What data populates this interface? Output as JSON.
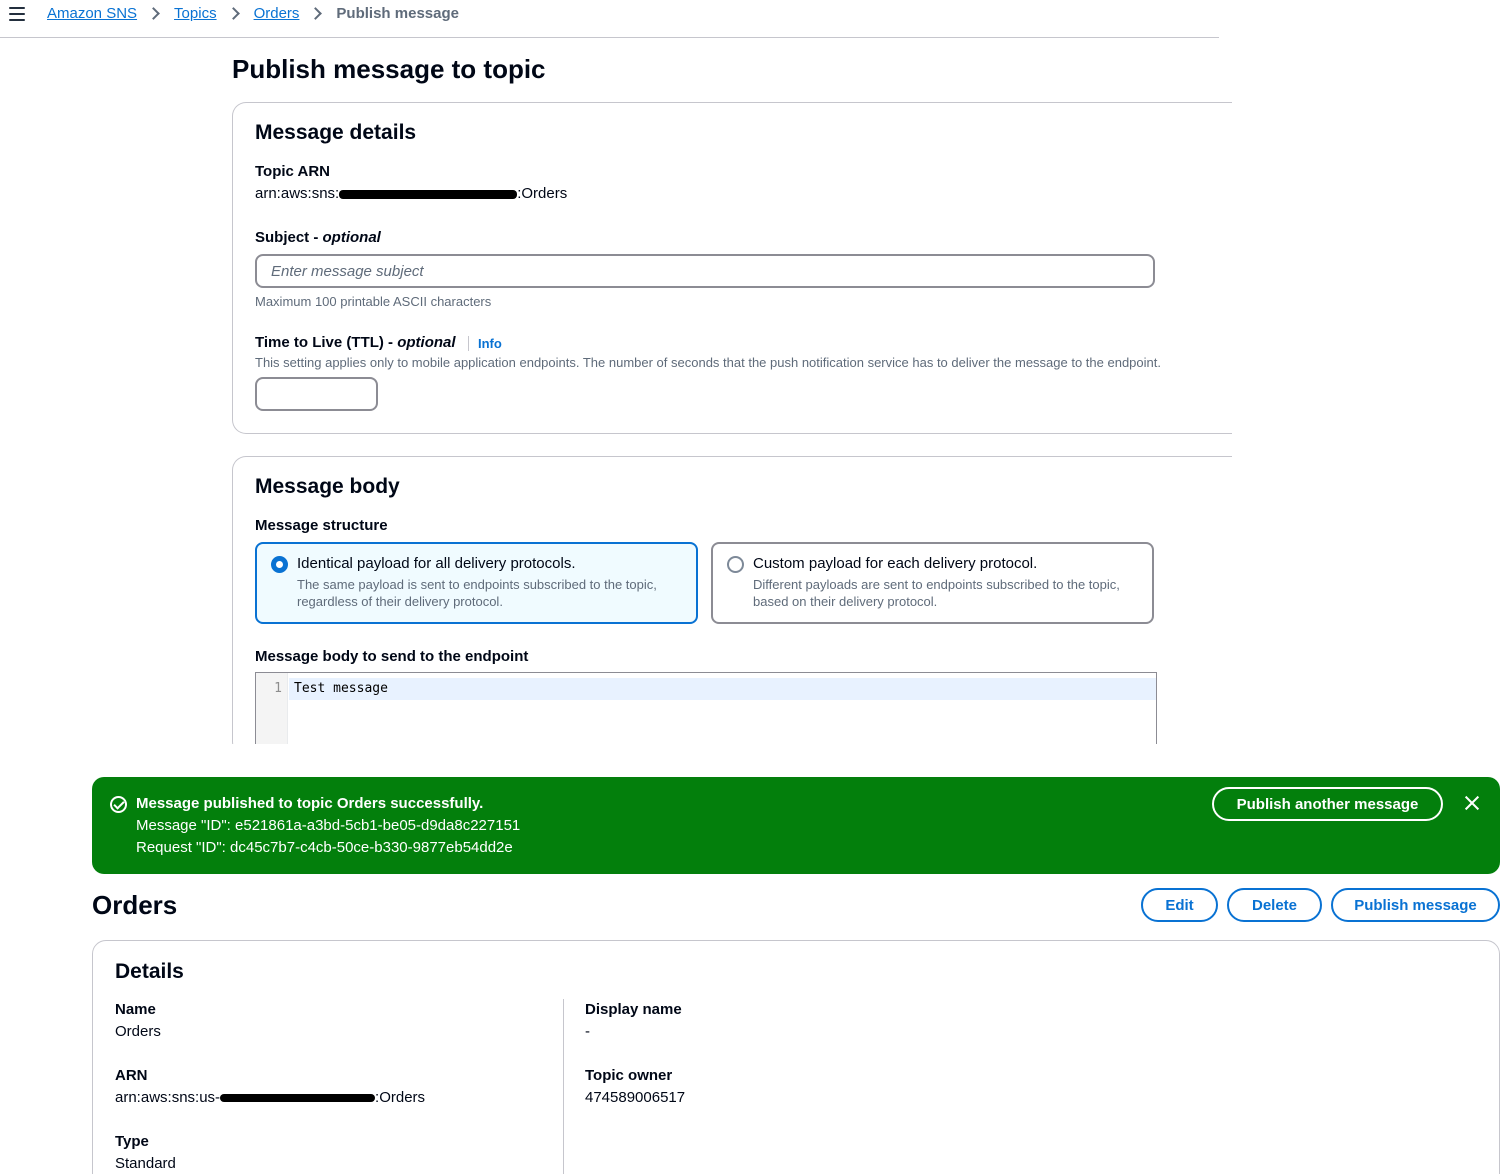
{
  "breadcrumb": {
    "items": [
      "Amazon SNS",
      "Topics",
      "Orders"
    ],
    "current": "Publish message"
  },
  "page_title": "Publish message to topic",
  "message_details": {
    "title": "Message details",
    "topic_arn_label": "Topic ARN",
    "topic_arn_prefix": "arn:aws:sns:",
    "topic_arn_suffix": ":Orders",
    "subject_label": "Subject - ",
    "subject_optional": "optional",
    "subject_placeholder": "Enter message subject",
    "subject_hint": "Maximum 100 printable ASCII characters",
    "ttl_label": "Time to Live (TTL) - ",
    "ttl_optional": "optional",
    "ttl_info": "Info",
    "ttl_hint": "This setting applies only to mobile application endpoints. The number of seconds that the push notification service has to deliver the message to the endpoint.",
    "ttl_value": ""
  },
  "message_body": {
    "title": "Message body",
    "structure_label": "Message structure",
    "options": [
      {
        "title": "Identical payload for all delivery protocols.",
        "description": "The same payload is sent to endpoints subscribed to the topic, regardless of their delivery protocol.",
        "selected": true
      },
      {
        "title": "Custom payload for each delivery protocol.",
        "description": "Different payloads are sent to endpoints subscribed to the topic, based on their delivery protocol.",
        "selected": false
      }
    ],
    "body_label": "Message body to send to the endpoint",
    "editor_line_number": "1",
    "editor_text": "Test message"
  },
  "flash": {
    "color": "#037f0c",
    "title": "Message published to topic Orders successfully.",
    "message_id": "Message \"ID\": e521861a-a3bd-5cb1-be05-d9da8c227151",
    "request_id": "Request \"ID\": dc45c7b7-c4cb-50ce-b330-9877eb54dd2e",
    "button": "Publish another message",
    "close_icon": "close-icon"
  },
  "topic": {
    "title": "Orders",
    "buttons": {
      "edit": "Edit",
      "delete": "Delete",
      "publish": "Publish message"
    },
    "details_title": "Details",
    "name_label": "Name",
    "name_value": "Orders",
    "arn_label": "ARN",
    "arn_prefix": "arn:aws:sns:us-",
    "arn_suffix": ":Orders",
    "type_label": "Type",
    "type_value": "Standard",
    "display_name_label": "Display name",
    "display_name_value": "-",
    "owner_label": "Topic owner",
    "owner_value": "474589006517"
  },
  "colors": {
    "link": "#0972d3",
    "success": "#037f0c",
    "text": "#000716",
    "muted": "#5f6b7a"
  }
}
